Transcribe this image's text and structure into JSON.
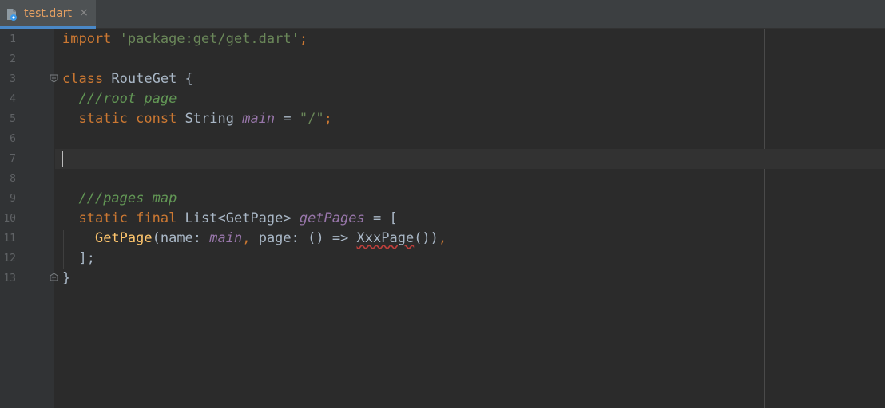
{
  "tab": {
    "label": "test.dart",
    "close_symbol": "×",
    "icon": "dart-file-icon"
  },
  "colors": {
    "background": "#2b2b2b",
    "keyword": "#cc7832",
    "string": "#6a8759",
    "comment": "#629755",
    "field": "#9876aa",
    "function": "#ffc66d",
    "text": "#a9b7c6",
    "tab_label": "#e8a162",
    "error_underline": "#bc3f3c"
  },
  "editor": {
    "current_line": 7,
    "line_numbers": [
      "1",
      "2",
      "3",
      "4",
      "5",
      "6",
      "7",
      "8",
      "9",
      "10",
      "11",
      "12",
      "13"
    ],
    "lines": [
      [
        {
          "t": "import",
          "c": "kw"
        },
        {
          "t": " ",
          "c": "plain"
        },
        {
          "t": "'package:get/get.dart'",
          "c": "str"
        },
        {
          "t": ";",
          "c": "kw"
        }
      ],
      [],
      [
        {
          "t": "class",
          "c": "kw"
        },
        {
          "t": " RouteGet {",
          "c": "plain"
        }
      ],
      [
        {
          "t": "  ",
          "c": "plain"
        },
        {
          "t": "///root page",
          "c": "cmt"
        }
      ],
      [
        {
          "t": "  ",
          "c": "plain"
        },
        {
          "t": "static const",
          "c": "kw"
        },
        {
          "t": " String ",
          "c": "plain"
        },
        {
          "t": "main",
          "c": "field"
        },
        {
          "t": " = ",
          "c": "plain"
        },
        {
          "t": "\"/\"",
          "c": "str"
        },
        {
          "t": ";",
          "c": "kw"
        }
      ],
      [],
      [],
      [],
      [
        {
          "t": "  ",
          "c": "plain"
        },
        {
          "t": "///pages map",
          "c": "cmt"
        }
      ],
      [
        {
          "t": "  ",
          "c": "plain"
        },
        {
          "t": "static final",
          "c": "kw"
        },
        {
          "t": " List<GetPage> ",
          "c": "plain"
        },
        {
          "t": "getPages",
          "c": "field"
        },
        {
          "t": " = [",
          "c": "plain"
        }
      ],
      [
        {
          "t": "    ",
          "c": "plain"
        },
        {
          "t": "GetPage",
          "c": "fn"
        },
        {
          "t": "(name: ",
          "c": "plain"
        },
        {
          "t": "main",
          "c": "field"
        },
        {
          "t": ", ",
          "c": "kw"
        },
        {
          "t": "page: () => ",
          "c": "plain"
        },
        {
          "t": "XxxPage",
          "c": "err"
        },
        {
          "t": "())",
          "c": "plain"
        },
        {
          "t": ",",
          "c": "kw"
        }
      ],
      [
        {
          "t": "  ];",
          "c": "plain"
        }
      ],
      [
        {
          "t": "}",
          "c": "plain"
        }
      ]
    ]
  }
}
